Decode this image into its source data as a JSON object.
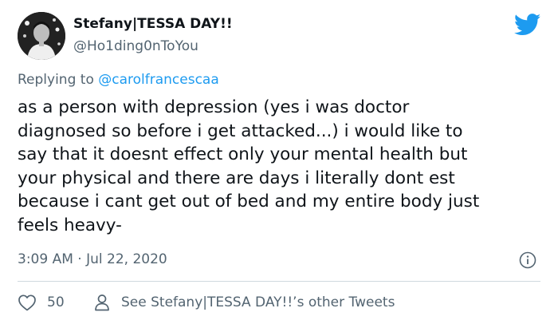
{
  "author": {
    "display_name": "Stefany|TESSA DAY!!",
    "handle": "@Ho1ding0nToYou",
    "avatar_icon": "user-avatar"
  },
  "reply": {
    "prefix": "Replying to ",
    "target": "@carolfrancescaa"
  },
  "tweet": {
    "lines": [
      "as a person with depression (yes i was doctor",
      "diagnosed so before i get attacked...) i would like to",
      "say that it doesnt effect only your mental health but",
      "your physical and there are days i literally dont est",
      "because i cant get out of bed and my entire body just",
      "feels heavy-"
    ]
  },
  "meta": {
    "timestamp": "3:09 AM · Jul 22, 2020"
  },
  "actions": {
    "like_count": "50",
    "profile_link": "See Stefany|TESSA DAY!!’s other Tweets"
  },
  "icons": {
    "brand": "twitter-bird-icon",
    "info": "info-icon",
    "like": "heart-icon",
    "profile": "person-icon"
  },
  "colors": {
    "brand_blue": "#1d9bf0",
    "text_primary": "#0f1419",
    "text_secondary": "#536471",
    "divider": "#cfd9de"
  }
}
